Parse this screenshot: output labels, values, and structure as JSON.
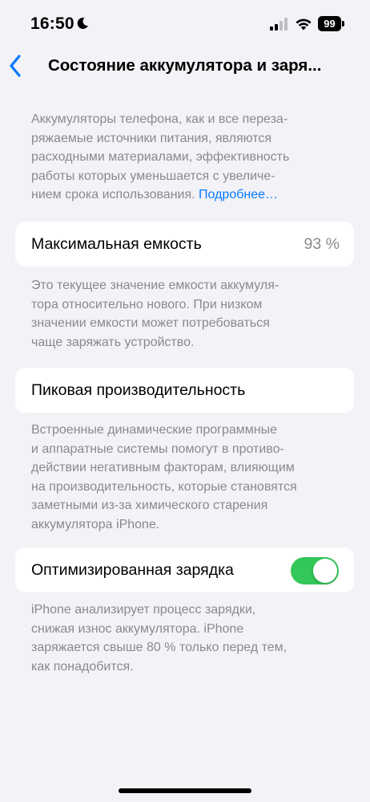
{
  "status_bar": {
    "time": "16:50",
    "battery_level": "99"
  },
  "nav": {
    "title": "Состояние аккумулятора и заря..."
  },
  "intro": {
    "lines": [
      "Аккумуляторы телефона, как и все переза-",
      "ряжаемые источники питания, являются",
      "расходными материалами, эффективность",
      "работы которых уменьшается с увеличе-",
      "нием срока использования. "
    ],
    "link": "Подробнее…"
  },
  "max_capacity": {
    "label": "Максимальная емкость",
    "value": "93 %",
    "footnote_lines": [
      "Это текущее значение емкости аккумуля-",
      "тора относительно нового. При низком",
      "значении емкости может потребоваться",
      "чаще заряжать устройство."
    ]
  },
  "peak_performance": {
    "label": "Пиковая производительность",
    "footnote_lines": [
      "Встроенные динамические программные",
      "и аппаратные системы помогут в противо-",
      "действии негативным факторам, влияющим",
      "на производительность, которые становятся",
      "заметными из-за химического старения",
      "аккумулятора iPhone."
    ]
  },
  "optimized_charging": {
    "label": "Оптимизированная зарядка",
    "enabled": true,
    "footnote_lines": [
      "iPhone анализирует процесс зарядки,",
      "снижая износ аккумулятора. iPhone",
      "заряжается свыше 80 % только перед тем,",
      "как понадобится."
    ]
  },
  "colors": {
    "background": "#f2f2f7",
    "accent": "#0a7aff",
    "toggle_on": "#34c759",
    "secondary_text": "#8a8a8e"
  }
}
